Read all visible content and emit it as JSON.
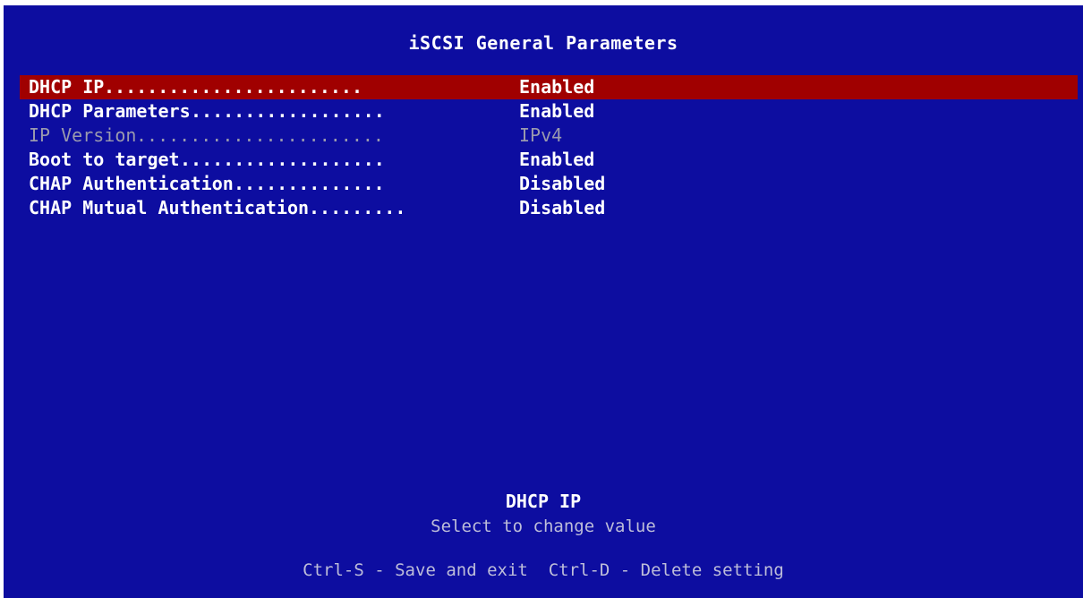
{
  "screen": {
    "title": "iSCSI General Parameters"
  },
  "menu": {
    "items": [
      {
        "label": "DHCP IP",
        "dots": "........................",
        "value": "Enabled",
        "state": "selected"
      },
      {
        "label": "DHCP Parameters",
        "dots": "..................",
        "value": "Enabled",
        "state": "normal"
      },
      {
        "label": "IP Version",
        "dots": ".......................",
        "value": "IPv4",
        "state": "disabled"
      },
      {
        "label": "Boot to target",
        "dots": "...................",
        "value": "Enabled",
        "state": "normal"
      },
      {
        "label": "CHAP Authentication",
        "dots": "..............",
        "value": "Disabled",
        "state": "normal"
      },
      {
        "label": "CHAP Mutual Authentication",
        "dots": ".........",
        "value": "Disabled",
        "state": "normal"
      }
    ]
  },
  "help": {
    "title": "DHCP IP",
    "text": "Select to change value"
  },
  "footer": {
    "text": "Ctrl-S - Save and exit  Ctrl-D - Delete setting"
  },
  "colors": {
    "background": "#0d0da0",
    "selection": "#a00000",
    "text": "#ffffff",
    "disabled_text": "#9a9aae"
  }
}
